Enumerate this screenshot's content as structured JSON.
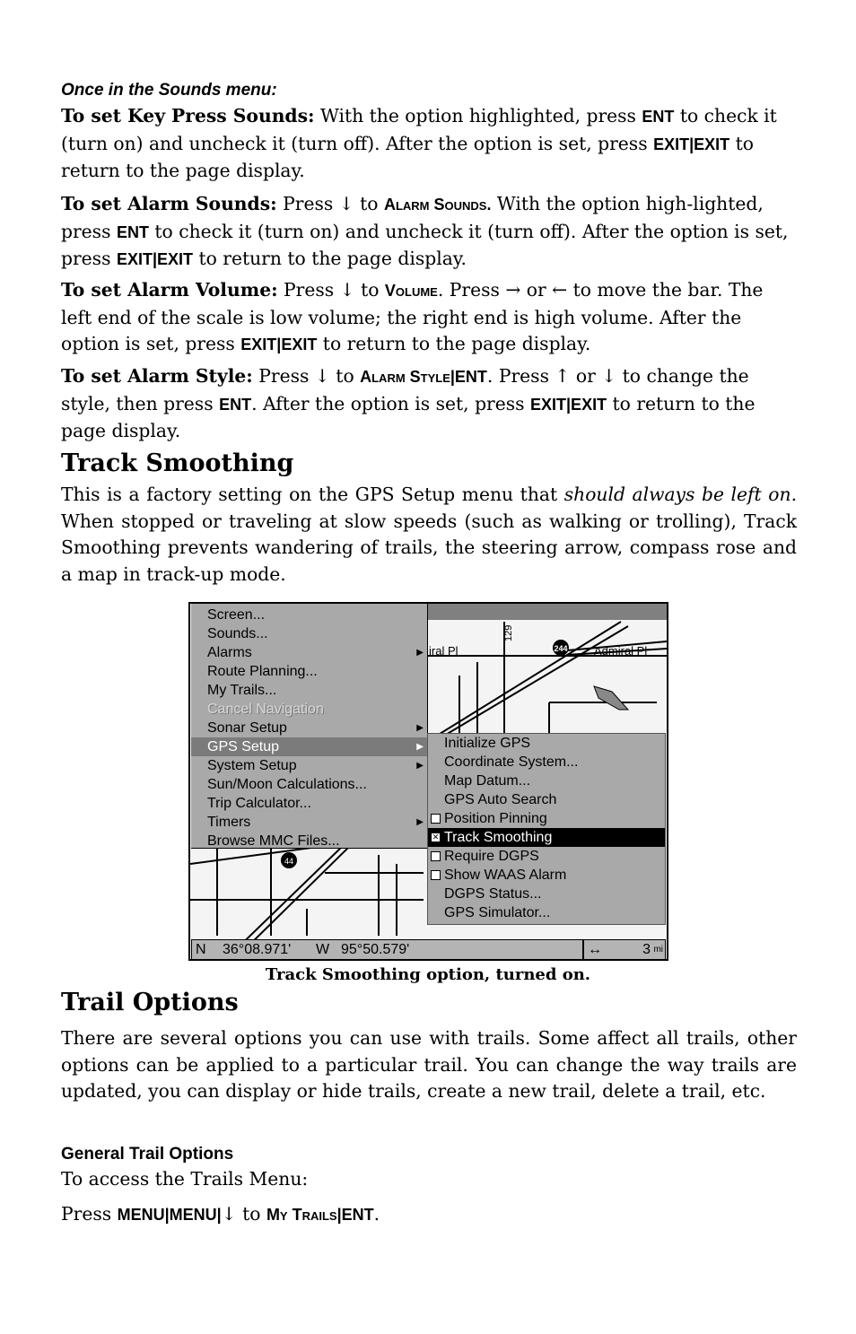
{
  "sounds_heading": "Once in the Sounds menu:",
  "paragraphs": [
    [
      {
        "s": "b",
        "t": "To set Key Press Sounds:"
      },
      {
        "s": "n",
        "t": " With the option highlighted, press "
      },
      {
        "s": "k",
        "t": "ENT"
      },
      {
        "s": "n",
        "t": " to check it (turn on) and uncheck it (turn off). After the option is set, press "
      },
      {
        "s": "k",
        "t": "EXIT|EXIT"
      },
      {
        "s": "n",
        "t": " to return to the page display."
      }
    ],
    [
      {
        "s": "b",
        "t": "To set Alarm Sounds:"
      },
      {
        "s": "n",
        "t": " Press ↓ to "
      },
      {
        "s": "sc",
        "t": "Alarm Sounds."
      },
      {
        "s": "n",
        "t": " With the option high-lighted, press "
      },
      {
        "s": "k",
        "t": "ENT"
      },
      {
        "s": "n",
        "t": " to check it (turn on) and uncheck it (turn off). After the option is set, press "
      },
      {
        "s": "k",
        "t": "EXIT|EXIT"
      },
      {
        "s": "n",
        "t": " to return to the page display."
      }
    ],
    [
      {
        "s": "b",
        "t": "To set Alarm Volume:"
      },
      {
        "s": "n",
        "t": " Press ↓ to "
      },
      {
        "s": "sc",
        "t": "Volume"
      },
      {
        "s": "n",
        "t": ". Press → or ← to move the bar. The left end of the scale is low volume; the right end is high volume. After the option is set, press "
      },
      {
        "s": "k",
        "t": "EXIT|EXIT"
      },
      {
        "s": "n",
        "t": " to return to the page display."
      }
    ],
    [
      {
        "s": "b",
        "t": "To set Alarm Style:"
      },
      {
        "s": "n",
        "t": " Press ↓ to "
      },
      {
        "s": "sc",
        "t": "Alarm Style|ENT"
      },
      {
        "s": "n",
        "t": ". Press ↑ or ↓ to change the style, then press "
      },
      {
        "s": "k",
        "t": "ENT"
      },
      {
        "s": "n",
        "t": ". After the option is set, press "
      },
      {
        "s": "k",
        "t": "EXIT|EXIT"
      },
      {
        "s": "n",
        "t": " to return to the page display."
      }
    ]
  ],
  "track_smoothing": {
    "title": "Track Smoothing",
    "body": [
      {
        "s": "n",
        "t": "This is a factory setting on the GPS Setup menu that "
      },
      {
        "s": "i",
        "t": "should always be left on"
      },
      {
        "s": "n",
        "t": ". When stopped or traveling at slow speeds (such as walking or trolling), Track Smoothing prevents wandering of trails, the steering arrow, compass rose and a map in track-up mode."
      }
    ]
  },
  "figure": {
    "main_menu": [
      {
        "label": "Screen..."
      },
      {
        "label": "Sounds..."
      },
      {
        "label": "Alarms",
        "arrow": true
      },
      {
        "label": "Route Planning..."
      },
      {
        "label": "My Trails..."
      },
      {
        "label": "Cancel Navigation",
        "disabled": true
      },
      {
        "label": "Sonar Setup",
        "arrow": true
      },
      {
        "label": "GPS Setup",
        "arrow": true,
        "selected": true
      },
      {
        "label": "System Setup",
        "arrow": true
      },
      {
        "label": "Sun/Moon Calculations..."
      },
      {
        "label": "Trip Calculator..."
      },
      {
        "label": "Timers",
        "arrow": true
      },
      {
        "label": "Browse MMC Files..."
      }
    ],
    "gps_menu": [
      {
        "label": "Initialize GPS"
      },
      {
        "label": "Coordinate System..."
      },
      {
        "label": "Map Datum..."
      },
      {
        "label": "GPS Auto Search"
      },
      {
        "label": "Position Pinning",
        "checkbox": false
      },
      {
        "label": "Track Smoothing",
        "checkbox": true,
        "selected": true
      },
      {
        "label": "Require DGPS",
        "checkbox": false
      },
      {
        "label": "Show WAAS Alarm",
        "checkbox": false
      },
      {
        "label": "DGPS Status..."
      },
      {
        "label": "GPS Simulator..."
      }
    ],
    "map_labels": {
      "street_left": "iral Pl",
      "street_right": "Admiral Pl",
      "highway_top": "244",
      "highway_bottom": "44",
      "road_number": "129"
    },
    "status": {
      "lat_hemi": "N",
      "lat": "36°08.971'",
      "lon_hemi": "W",
      "lon": "95°50.579'",
      "zoom_icon": "↔",
      "zoom_value": "3",
      "zoom_unit": "mi"
    },
    "caption": "Track Smoothing option, turned on."
  },
  "trail_options": {
    "title": "Trail Options",
    "body": "There are several options you can use with trails. Some affect all trails, other options can be applied to a particular trail. You can change the way trails are updated, you can display or hide trails, create a new trail, delete a trail, etc.",
    "general_heading": "General Trail Options",
    "access_text": "To access the Trails Menu:",
    "press_line": [
      {
        "s": "n",
        "t": "Press "
      },
      {
        "s": "k",
        "t": "MENU|MENU|"
      },
      {
        "s": "n",
        "t": "↓ to "
      },
      {
        "s": "sc",
        "t": "My Trails|ENT"
      },
      {
        "s": "n",
        "t": "."
      }
    ]
  }
}
